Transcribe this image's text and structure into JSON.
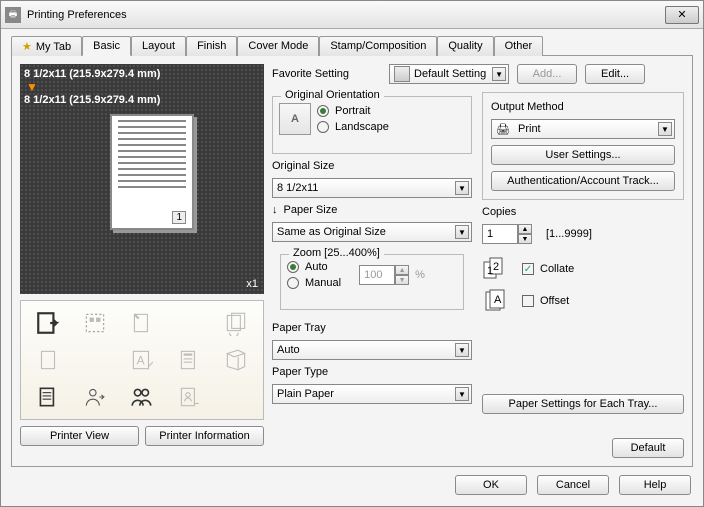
{
  "window": {
    "title": "Printing Preferences",
    "close_glyph": "✕"
  },
  "tabs": [
    "My Tab",
    "Basic",
    "Layout",
    "Finish",
    "Cover Mode",
    "Stamp/Composition",
    "Quality",
    "Other"
  ],
  "active_tab": "Basic",
  "favorite": {
    "label": "Favorite Setting",
    "value": "Default Setting",
    "add": "Add...",
    "edit": "Edit..."
  },
  "preview": {
    "size1": "8 1/2x11 (215.9x279.4 mm)",
    "size2": "8 1/2x11 (215.9x279.4 mm)",
    "page_num": "1",
    "count": "x1"
  },
  "printer_view_btn": "Printer View",
  "printer_info_btn": "Printer Information",
  "orientation": {
    "title": "Original Orientation",
    "portrait": "Portrait",
    "landscape": "Landscape",
    "selected": "portrait",
    "icon_letter": "A"
  },
  "original_size": {
    "label": "Original Size",
    "value": "8 1/2x11"
  },
  "paper_size": {
    "label": "Paper Size",
    "arrow": "↓",
    "value": "Same as Original Size"
  },
  "zoom": {
    "title": "Zoom [25...400%]",
    "auto": "Auto",
    "manual": "Manual",
    "selected": "auto",
    "value": "100",
    "pct": "%"
  },
  "paper_tray": {
    "label": "Paper Tray",
    "value": "Auto"
  },
  "paper_type": {
    "label": "Paper Type",
    "value": "Plain Paper"
  },
  "output": {
    "title": "Output Method",
    "value": "Print",
    "user_settings": "User Settings...",
    "auth": "Authentication/Account Track..."
  },
  "copies": {
    "label": "Copies",
    "value": "1",
    "range": "[1...9999]",
    "collate": "Collate",
    "collate_checked": true,
    "offset": "Offset",
    "offset_checked": false
  },
  "paper_settings_btn": "Paper Settings for Each Tray...",
  "default_btn": "Default",
  "buttons": {
    "ok": "OK",
    "cancel": "Cancel",
    "help": "Help"
  }
}
